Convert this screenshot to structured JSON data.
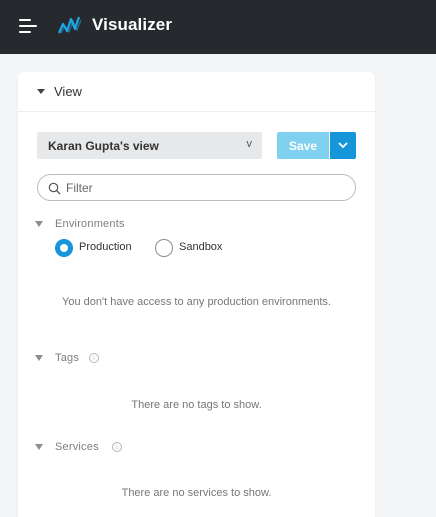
{
  "topbar": {
    "app_title": "Visualizer",
    "menu_icon": "hamburger-menu-icon",
    "logo_icon": "visualizer-logo-icon",
    "logo_color": "#1ea7e4",
    "background": "#26292d"
  },
  "panel": {
    "title": "View",
    "view_select": {
      "value": "Karan Gupta's view",
      "chevron": "v"
    },
    "save_button": {
      "label": "Save",
      "color": "#80d1ef"
    },
    "save_dropdown": {
      "icon": "chevron-down-icon",
      "color": "#1496d8"
    },
    "filter": {
      "placeholder": "Filter",
      "value": ""
    },
    "environments": {
      "title": "Environments",
      "options": [
        {
          "label": "Production",
          "selected": true
        },
        {
          "label": "Sandbox",
          "selected": false
        }
      ],
      "message": "You don't have access to any production environments."
    },
    "tags": {
      "title": "Tags",
      "info": "i",
      "message": "There are no tags to show."
    },
    "services": {
      "title": "Services",
      "info": "i",
      "message": "There are no services to show."
    }
  }
}
